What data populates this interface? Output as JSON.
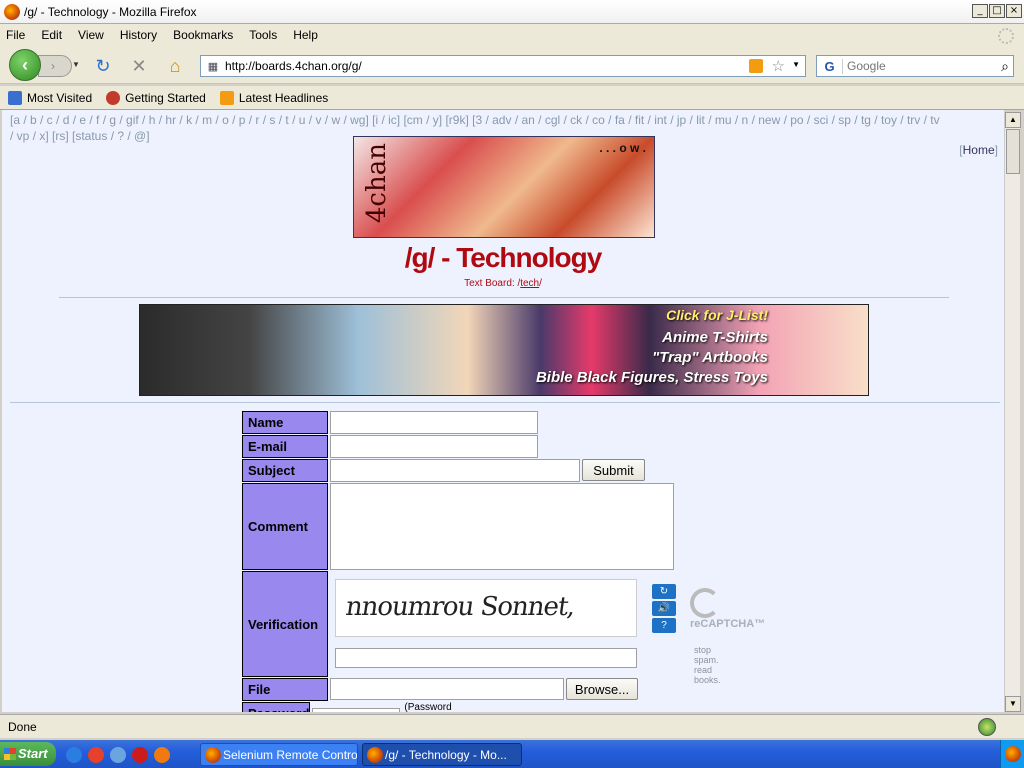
{
  "window": {
    "title": "/g/ - Technology - Mozilla Firefox",
    "buttons": [
      "_",
      "□",
      "×"
    ]
  },
  "menu": [
    "File",
    "Edit",
    "View",
    "History",
    "Bookmarks",
    "Tools",
    "Help"
  ],
  "nav": {
    "url": "http://boards.4chan.org/g/",
    "search_placeholder": "Google",
    "search_engine": "G"
  },
  "bookmarks": [
    {
      "label": "Most Visited",
      "icon": "bookmarks-folder-icon",
      "color": "#3a6fd0"
    },
    {
      "label": "Getting Started",
      "icon": "firefox-icon",
      "color": "#c23a2a"
    },
    {
      "label": "Latest Headlines",
      "icon": "rss-feed-icon",
      "color": "#f39c12"
    }
  ],
  "board_nav": {
    "line1": "[a / b / c / d / e / f / g / gif / h / hr / k / m / o / p / r / s / t / u / v / w / wg] [i / ic] [cm / y] [r9k] [3 / adv / an / cgl / ck / co / fa / fit / int / jp / lit / mu / n / new / po / sci / sp / tg / toy / trv / tv",
    "line2": "/ vp / x] [rs] [status / ? / @]",
    "home_open": "[",
    "home": "Home",
    "home_close": "]"
  },
  "logo": {
    "side_text": "4chan",
    "corner_text": ". . . o w ."
  },
  "board": {
    "title": "/g/ - Technology",
    "sub_prefix": "Text Board: /",
    "sub_link": "tech",
    "sub_suffix": "/"
  },
  "banner": {
    "line1": "Click for J-List!",
    "line2": "Anime T-Shirts",
    "line3": "\"Trap\" Artbooks",
    "line4": "Bible Black Figures, Stress Toys"
  },
  "form": {
    "name_label": "Name",
    "email_label": "E-mail",
    "subject_label": "Subject",
    "submit": "Submit",
    "comment_label": "Comment",
    "verification_label": "Verification",
    "captcha_text": "nnoumrou Sonnet,",
    "file_label": "File",
    "browse": "Browse...",
    "password_label": "Password",
    "password_note": "(Password used for file deletion)"
  },
  "recaptcha": {
    "buttons": [
      "↻",
      "🔊",
      "?"
    ],
    "logo": "reCAPTCHA™",
    "tag1": "stop spam.",
    "tag2": "read books."
  },
  "status": {
    "text": "Done"
  },
  "taskbar": {
    "start": "Start",
    "quick_launch": [
      {
        "name": "ie-icon",
        "color": "#2a7de1"
      },
      {
        "name": "chrome-icon",
        "color": "#e6412a"
      },
      {
        "name": "globe-icon",
        "color": "#6aa5e0"
      },
      {
        "name": "opera-icon",
        "color": "#cc1b1b"
      },
      {
        "name": "firefox-icon",
        "color": "#f07a10"
      }
    ],
    "tasks": [
      "Selenium Remote Control...",
      "/g/ - Technology - Mo..."
    ]
  }
}
